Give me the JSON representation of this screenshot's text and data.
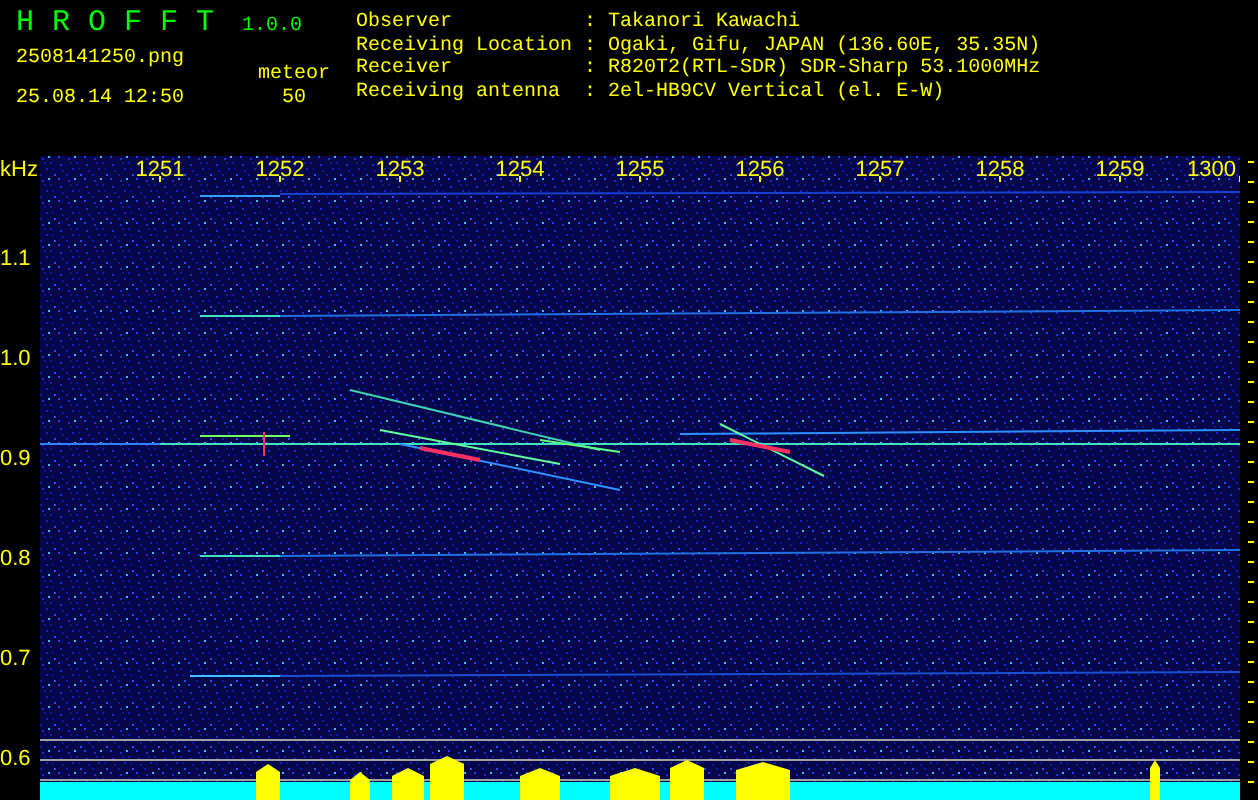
{
  "app": {
    "title": "H R O F F T",
    "version": "1.0.0"
  },
  "file_name": "2508141250.png",
  "timestamp": "25.08.14 12:50",
  "counter": {
    "label": "meteor",
    "value": "50"
  },
  "station_info": [
    {
      "label": "Observer",
      "separator": ":",
      "value": "Takanori Kawachi"
    },
    {
      "label": "Receiving Location",
      "separator": ":",
      "value": "Ogaki, Gifu, JAPAN (136.60E, 35.35N)"
    },
    {
      "label": "Receiver",
      "separator": ":",
      "value": "R820T2(RTL-SDR) SDR-Sharp 53.1000MHz"
    },
    {
      "label": "Receiving antenna",
      "separator": ":",
      "value": "2el-HB9CV Vertical (el. E-W)"
    }
  ],
  "spectrogram": {
    "y_unit": "kHz",
    "x_labels": [
      "1251",
      "1252",
      "1253",
      "1254",
      "1255",
      "1256",
      "1257",
      "1258",
      "1259",
      "1300"
    ],
    "y_labels": [
      "1.1",
      "1.0",
      "0.9",
      "0.8",
      "0.7",
      "0.6"
    ]
  }
}
